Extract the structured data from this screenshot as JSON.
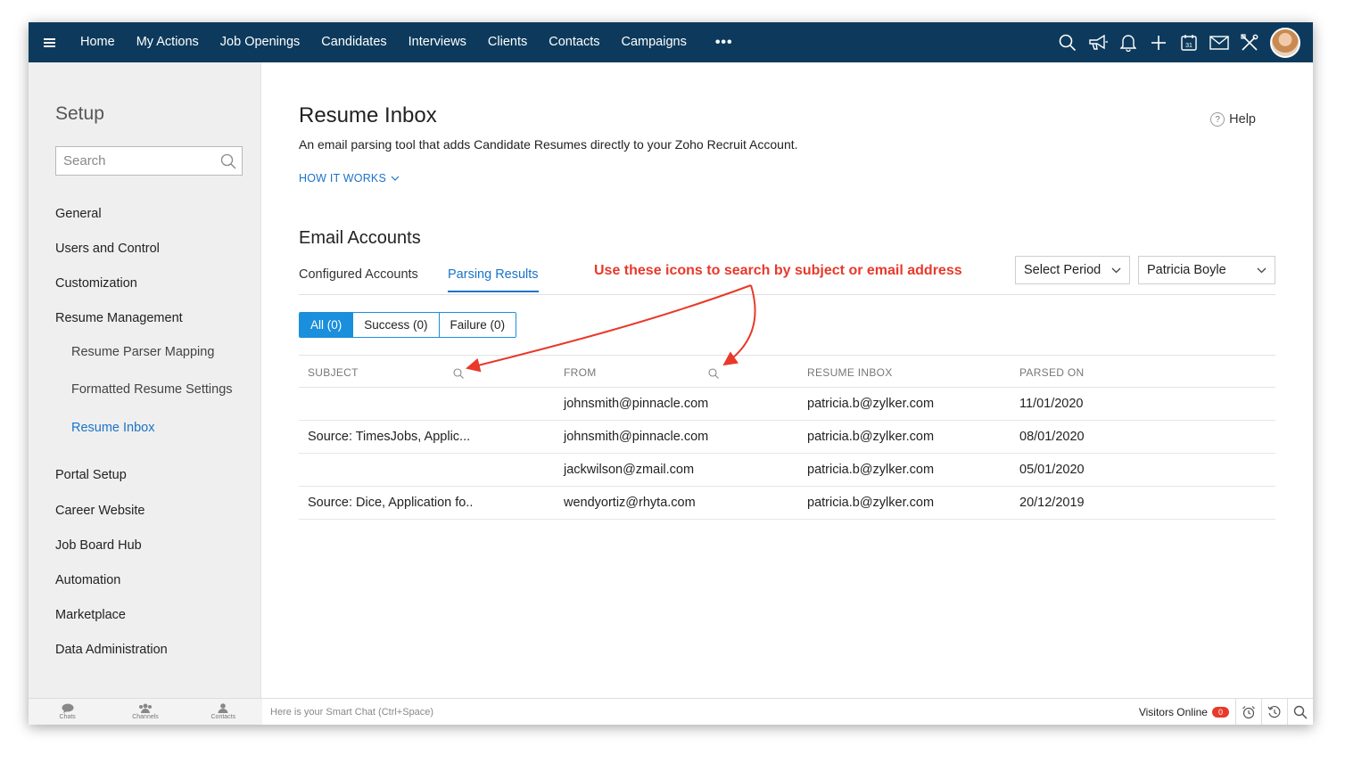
{
  "nav": {
    "items": [
      "Home",
      "My Actions",
      "Job Openings",
      "Candidates",
      "Interviews",
      "Clients",
      "Contacts",
      "Campaigns"
    ],
    "more": "•••",
    "icons": [
      "search-icon",
      "megaphone-icon",
      "bell-icon",
      "plus-icon",
      "calendar-icon",
      "mail-icon",
      "tools-icon"
    ],
    "calendar_day": "31",
    "bg_color": "#0d3a5c"
  },
  "sidebar": {
    "title": "Setup",
    "search_placeholder": "Search",
    "items": [
      {
        "label": "General"
      },
      {
        "label": "Users and Control"
      },
      {
        "label": "Customization"
      },
      {
        "label": "Resume Management"
      },
      {
        "label": "Resume Parser Mapping"
      },
      {
        "label": "Formatted Resume Settings"
      },
      {
        "label": "Resume Inbox"
      },
      {
        "label": "Portal Setup"
      },
      {
        "label": "Career Website"
      },
      {
        "label": "Job Board Hub"
      },
      {
        "label": "Automation"
      },
      {
        "label": "Marketplace"
      },
      {
        "label": "Data Administration"
      }
    ]
  },
  "main": {
    "title": "Resume Inbox",
    "description": "An email parsing tool that adds Candidate Resumes directly to your Zoho Recruit Account.",
    "how_it_works": "HOW IT WORKS",
    "help": "Help",
    "help_icon": "?",
    "section_title": "Email Accounts",
    "tabs": [
      "Configured Accounts",
      "Parsing Results"
    ],
    "annotation": "Use these icons to search by subject or email address",
    "period_select": "Select Period",
    "user_select": "Patricia Boyle",
    "filters": [
      "All (0)",
      "Success (0)",
      "Failure (0)"
    ],
    "table": {
      "headers": [
        "SUBJECT",
        "FROM",
        "RESUME INBOX",
        "PARSED ON"
      ],
      "rows": [
        {
          "subject": "",
          "from": "johnsmith@pinnacle.com",
          "inbox": "patricia.b@zylker.com",
          "date": "11/01/2020"
        },
        {
          "subject": "Source: TimesJobs, Applic...",
          "from": "johnsmith@pinnacle.com",
          "inbox": "patricia.b@zylker.com",
          "date": "08/01/2020"
        },
        {
          "subject": "",
          "from": "jackwilson@zmail.com",
          "inbox": "patricia.b@zylker.com",
          "date": "05/01/2020"
        },
        {
          "subject": "Source: Dice, Application fo..",
          "from": "wendyortiz@rhyta.com",
          "inbox": "patricia.b@zylker.com",
          "date": "20/12/2019"
        }
      ]
    },
    "accent_color": "#1a73c8",
    "annotation_color": "#e8392a"
  },
  "bottombar": {
    "tabs": [
      "Chats",
      "Channels",
      "Contacts"
    ],
    "smartchat_placeholder": "Here is your Smart Chat (Ctrl+Space)",
    "visitors_label": "Visitors Online",
    "visitors_count": "0"
  }
}
